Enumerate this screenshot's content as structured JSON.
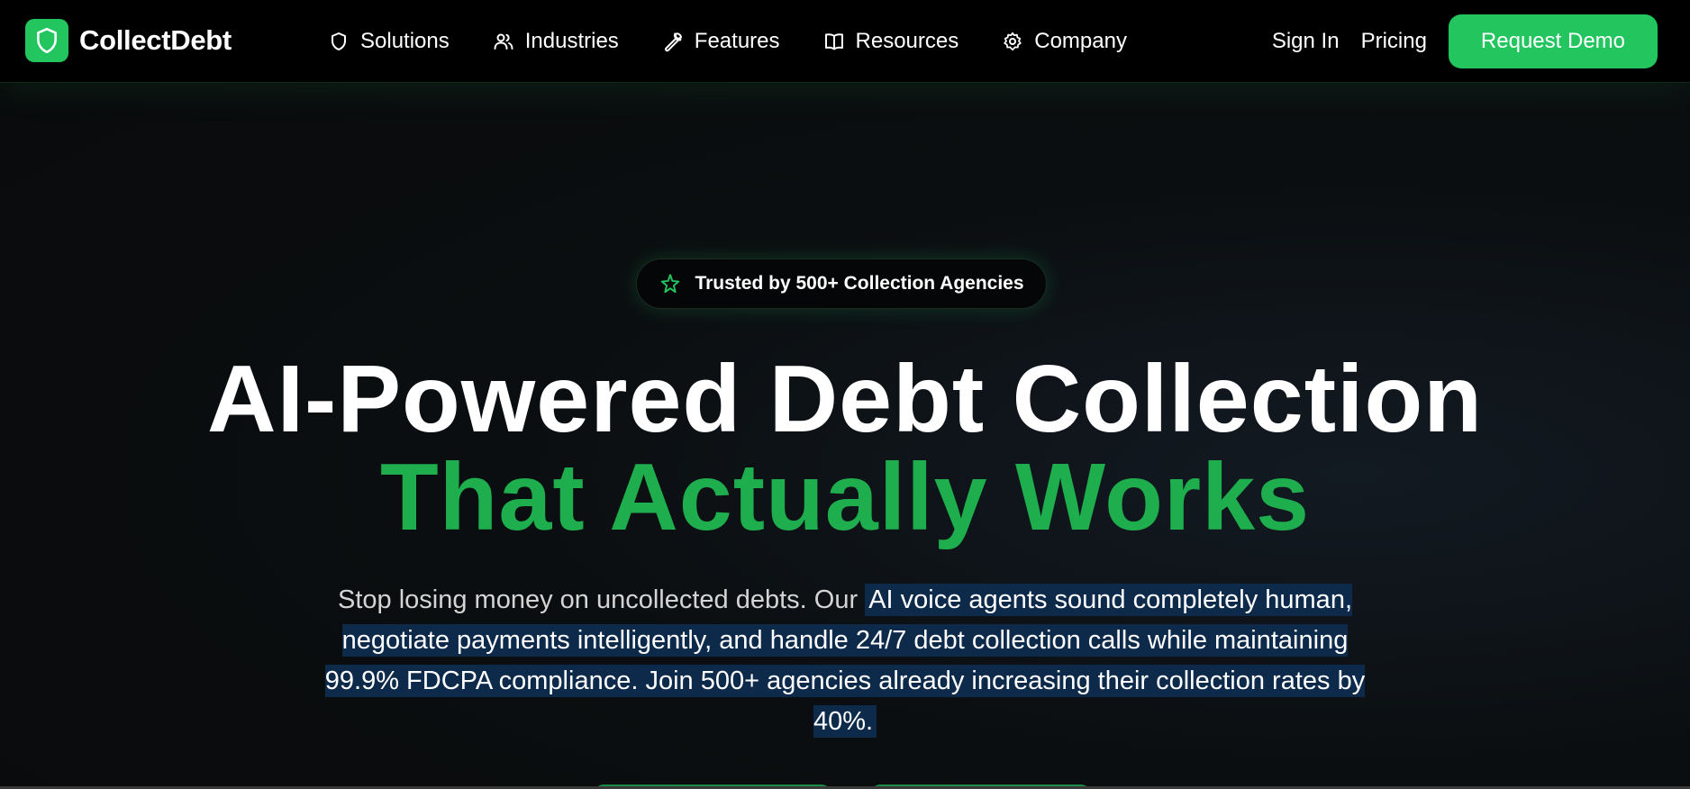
{
  "nav": {
    "brand": "CollectDebt",
    "links": [
      {
        "label": "Solutions",
        "icon": "shield-icon"
      },
      {
        "label": "Industries",
        "icon": "users-icon"
      },
      {
        "label": "Features",
        "icon": "wrench-icon"
      },
      {
        "label": "Resources",
        "icon": "book-icon"
      },
      {
        "label": "Company",
        "icon": "gear-icon"
      }
    ],
    "sign_in": "Sign In",
    "pricing": "Pricing",
    "cta": "Request Demo"
  },
  "hero": {
    "badge": "Trusted by 500+ Collection Agencies",
    "badge_icon": "sparkle-icon",
    "headline_line1": "AI-Powered Debt Collection",
    "headline_line2": "That Actually Works",
    "subtext_plain": "Stop losing money on uncollected debts. Our ",
    "subtext_selected": "AI voice agents sound completely human, negotiate payments intelligently, and handle 24/7 debt collection calls while maintaining 99.9% FDCPA compliance. Join 500+ agencies already increasing their collection rates by 40%."
  },
  "colors": {
    "accent": "#22c55e",
    "headline_accent": "#1fae4e",
    "selection": "#0d2a4a",
    "background": "#0a0c0d"
  }
}
